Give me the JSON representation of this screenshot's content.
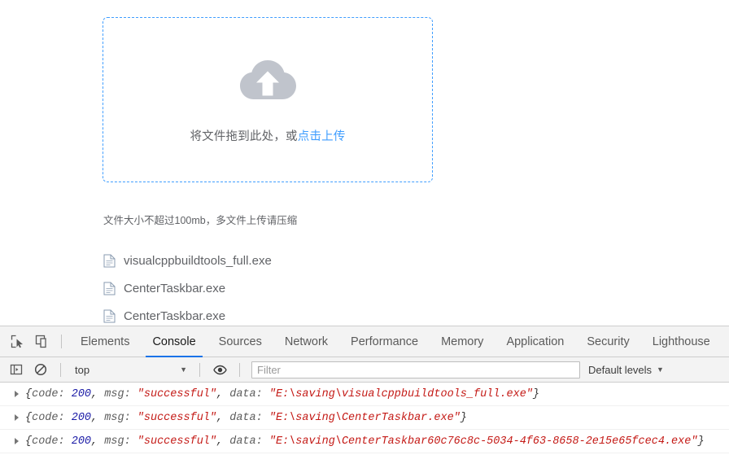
{
  "page": {
    "dropzone": {
      "icon": "cloud-upload-icon",
      "text_before": "将文件拖到此处，或",
      "link_text": "点击上传"
    },
    "tip": "文件大小不超过100mb，多文件上传请压缩",
    "files": [
      {
        "icon": "document-icon",
        "name": "visualcppbuildtools_full.exe"
      },
      {
        "icon": "document-icon",
        "name": "CenterTaskbar.exe"
      },
      {
        "icon": "document-icon",
        "name": "CenterTaskbar.exe"
      }
    ]
  },
  "devtools": {
    "left_icons": [
      {
        "name": "inspect-element-icon"
      },
      {
        "name": "device-toolbar-icon"
      }
    ],
    "tabs": [
      {
        "label": "Elements",
        "active": false
      },
      {
        "label": "Console",
        "active": true
      },
      {
        "label": "Sources",
        "active": false
      },
      {
        "label": "Network",
        "active": false
      },
      {
        "label": "Performance",
        "active": false
      },
      {
        "label": "Memory",
        "active": false
      },
      {
        "label": "Application",
        "active": false
      },
      {
        "label": "Security",
        "active": false
      },
      {
        "label": "Lighthouse",
        "active": false
      }
    ],
    "console_bar": {
      "sidebar_icon": "console-sidebar-icon",
      "clear_icon": "clear-console-icon",
      "context": "top",
      "context_caret": "▼",
      "eye_icon": "live-expression-eye-icon",
      "filter_placeholder": "Filter",
      "filter_value": "",
      "levels_label": "Default levels",
      "levels_caret": "▼"
    },
    "logs": [
      {
        "open_brace": "{",
        "code_key": "code:",
        "code_value": "200",
        "comma1": ",",
        "msg_key": "msg:",
        "msg_value": "\"successful\"",
        "comma2": ",",
        "data_key": "data:",
        "data_value": "\"E:\\saving\\visualcppbuildtools_full.exe\"",
        "close_brace": "}"
      },
      {
        "open_brace": "{",
        "code_key": "code:",
        "code_value": "200",
        "comma1": ",",
        "msg_key": "msg:",
        "msg_value": "\"successful\"",
        "comma2": ",",
        "data_key": "data:",
        "data_value": "\"E:\\saving\\CenterTaskbar.exe\"",
        "close_brace": "}"
      },
      {
        "open_brace": "{",
        "code_key": "code:",
        "code_value": "200",
        "comma1": ",",
        "msg_key": "msg:",
        "msg_value": "\"successful\"",
        "comma2": ",",
        "data_key": "data:",
        "data_value": "\"E:\\saving\\CenterTaskbar60c76c8c-5034-4f63-8658-2e15e65fcec4.exe\"",
        "close_brace": "}"
      }
    ]
  },
  "colors": {
    "accent_blue": "#409eff",
    "tab_active_underline": "#1a73e8",
    "cloud_gray": "#c0c4cc",
    "string_red": "#c41a16",
    "number_blue": "#1a1aa6"
  }
}
